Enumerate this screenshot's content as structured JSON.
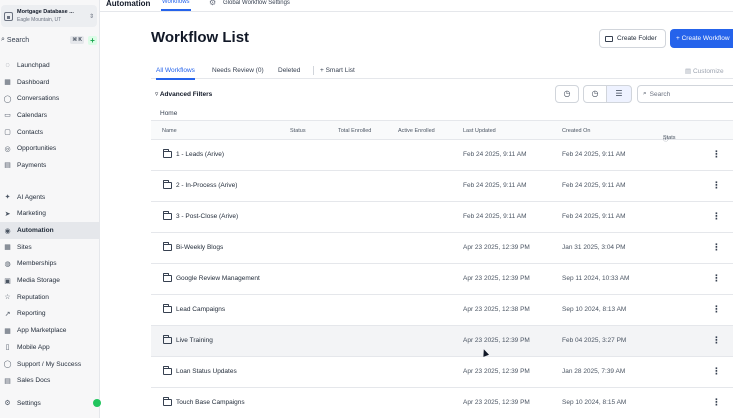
{
  "account": {
    "name": "Mortgage Database ...",
    "location": "Eagle Mountain, UT"
  },
  "search": {
    "label": "Search",
    "shortcut": "⌘ K"
  },
  "sidebar": {
    "group1": [
      {
        "label": "Launchpad",
        "icon": "rocket-icon",
        "glyph": "◌"
      },
      {
        "label": "Dashboard",
        "icon": "dashboard-icon",
        "glyph": "▦"
      },
      {
        "label": "Conversations",
        "icon": "chat-icon",
        "glyph": "◯"
      },
      {
        "label": "Calendars",
        "icon": "calendar-icon",
        "glyph": "▭"
      },
      {
        "label": "Contacts",
        "icon": "contacts-icon",
        "glyph": "▢"
      },
      {
        "label": "Opportunities",
        "icon": "opportunities-icon",
        "glyph": "◎"
      },
      {
        "label": "Payments",
        "icon": "payments-icon",
        "glyph": "▤"
      }
    ],
    "group2": [
      {
        "label": "AI Agents",
        "icon": "ai-icon",
        "glyph": "✦"
      },
      {
        "label": "Marketing",
        "icon": "marketing-icon",
        "glyph": "➤"
      },
      {
        "label": "Automation",
        "icon": "automation-icon",
        "glyph": "◉",
        "active": true
      },
      {
        "label": "Sites",
        "icon": "sites-icon",
        "glyph": "▦"
      },
      {
        "label": "Memberships",
        "icon": "memberships-icon",
        "glyph": "◍"
      },
      {
        "label": "Media Storage",
        "icon": "media-icon",
        "glyph": "▣"
      },
      {
        "label": "Reputation",
        "icon": "star-icon",
        "glyph": "☆"
      },
      {
        "label": "Reporting",
        "icon": "reporting-icon",
        "glyph": "↗"
      },
      {
        "label": "App Marketplace",
        "icon": "marketplace-icon",
        "glyph": "▦"
      },
      {
        "label": "Mobile App",
        "icon": "mobile-icon",
        "glyph": "▯"
      },
      {
        "label": "Support / My Success",
        "icon": "support-icon",
        "glyph": "◯"
      },
      {
        "label": "Sales Docs",
        "icon": "docs-icon",
        "glyph": "▤"
      }
    ],
    "settings": "Settings"
  },
  "topbar": {
    "title": "Automation",
    "tab": "Workflows",
    "link": "Global Workflow Settings"
  },
  "main": {
    "title": "Workflow List",
    "create_folder": "Create Folder",
    "create_workflow": "+ Create Workflow",
    "tabs": [
      "All Workflows",
      "Needs Review (0)",
      "Deleted"
    ],
    "smart_list": "+ Smart List",
    "customize": "Customize",
    "advanced_filters": "Advanced Filters",
    "search_placeholder": "Search",
    "breadcrumb": "Home",
    "columns": [
      "Name",
      "Status",
      "Total Enrolled",
      "Active Enrolled",
      "Last Updated",
      "Created On",
      "Stats"
    ],
    "rows": [
      {
        "name": "1 - Leads (Arive)",
        "updated": "Feb 24 2025, 9:11 AM",
        "created": "Feb 24 2025, 9:11 AM"
      },
      {
        "name": "2 - In-Process (Arive)",
        "updated": "Feb 24 2025, 9:11 AM",
        "created": "Feb 24 2025, 9:11 AM"
      },
      {
        "name": "3 - Post-Close (Arive)",
        "updated": "Feb 24 2025, 9:11 AM",
        "created": "Feb 24 2025, 9:11 AM"
      },
      {
        "name": "Bi-Weekly Blogs",
        "updated": "Apr 23 2025, 12:39 PM",
        "created": "Jan 31 2025, 3:04 PM"
      },
      {
        "name": "Google Review Management",
        "updated": "Apr 23 2025, 12:39 PM",
        "created": "Sep 11 2024, 10:33 AM"
      },
      {
        "name": "Lead Campaigns",
        "updated": "Apr 23 2025, 12:38 PM",
        "created": "Sep 10 2024, 8:13 AM"
      },
      {
        "name": "Live Training",
        "updated": "Apr 23 2025, 12:39 PM",
        "created": "Feb 04 2025, 3:27 PM"
      },
      {
        "name": "Loan Status Updates",
        "updated": "Apr 23 2025, 12:39 PM",
        "created": "Jan 28 2025, 7:39 AM"
      },
      {
        "name": "Touch Base Campaigns",
        "updated": "Apr 23 2025, 12:39 PM",
        "created": "Sep 10 2024, 8:15 AM"
      }
    ]
  }
}
